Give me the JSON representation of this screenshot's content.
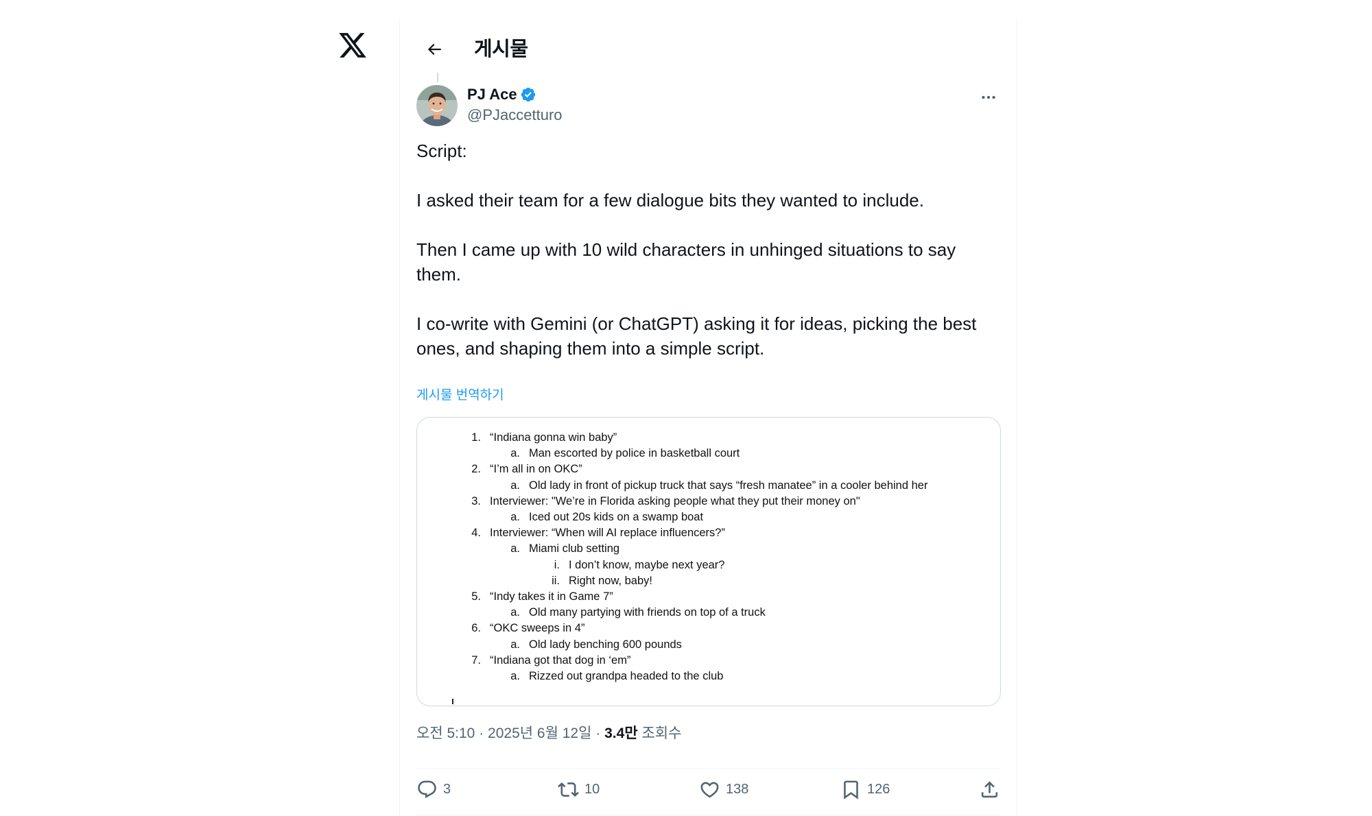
{
  "app": {
    "logo_icon": "x-logo-icon",
    "header_title": "게시물"
  },
  "post": {
    "author": {
      "display_name": "PJ Ace",
      "handle": "@PJaccetturo",
      "verified": true,
      "verified_color": "#1d9bf0"
    },
    "text_paragraphs": [
      "Script:",
      "I asked their team for a few dialogue bits they wanted to include.",
      "Then I came up with 10 wild characters in unhinged situations to say\nthem.",
      "I co-write with Gemini (or ChatGPT) asking it for ideas, picking the best\nones, and shaping them into a simple script."
    ],
    "translate_label": "게시물 번역하기",
    "image_document": {
      "lines": [
        {
          "marker": "1.",
          "text": "“Indiana gonna win baby”",
          "level": 0
        },
        {
          "marker": "a.",
          "text": "Man escorted by police in basketball court",
          "level": 1
        },
        {
          "marker": "2.",
          "text": "“I’m all in on OKC”",
          "level": 0
        },
        {
          "marker": "a.",
          "text": "Old lady in front of pickup truck that says “fresh manatee” in a cooler behind her",
          "level": 1
        },
        {
          "marker": "3.",
          "text": "Interviewer: \"We’re in Florida asking people what they put their money on\"",
          "level": 0
        },
        {
          "marker": "a.",
          "text": "Iced out 20s kids on a swamp boat",
          "level": 1
        },
        {
          "marker": "4.",
          "text": "Interviewer: “When will AI replace influencers?”",
          "level": 0
        },
        {
          "marker": "a.",
          "text": "Miami club setting",
          "level": 1
        },
        {
          "marker": "i.",
          "text": "I don’t know, maybe next year?",
          "level": 2
        },
        {
          "marker": "ii.",
          "text": "Right now, baby!",
          "level": 2
        },
        {
          "marker": "5.",
          "text": "“Indy takes it in Game 7”",
          "level": 0
        },
        {
          "marker": "a.",
          "text": "Old many partying with friends on top of a truck",
          "level": 1
        },
        {
          "marker": "6.",
          "text": "“OKC sweeps in 4”",
          "level": 0
        },
        {
          "marker": "a.",
          "text": "Old lady benching 600 pounds",
          "level": 1
        },
        {
          "marker": "7.",
          "text": "“Indiana got that dog in ‘em”",
          "level": 0
        },
        {
          "marker": "a.",
          "text": "Rizzed out grandpa headed to the club",
          "level": 1
        }
      ]
    },
    "meta": {
      "time": "오전 5:10",
      "separator": "·",
      "date": "2025년 6월 12일",
      "views_count": "3.4만",
      "views_label": "조회수"
    },
    "actions": {
      "replies": "3",
      "reposts": "10",
      "likes": "138",
      "bookmarks": "126"
    },
    "action_icons": {
      "reply": "reply-icon",
      "repost": "repost-icon",
      "like": "heart-icon",
      "bookmark": "bookmark-icon",
      "share": "share-icon"
    }
  }
}
